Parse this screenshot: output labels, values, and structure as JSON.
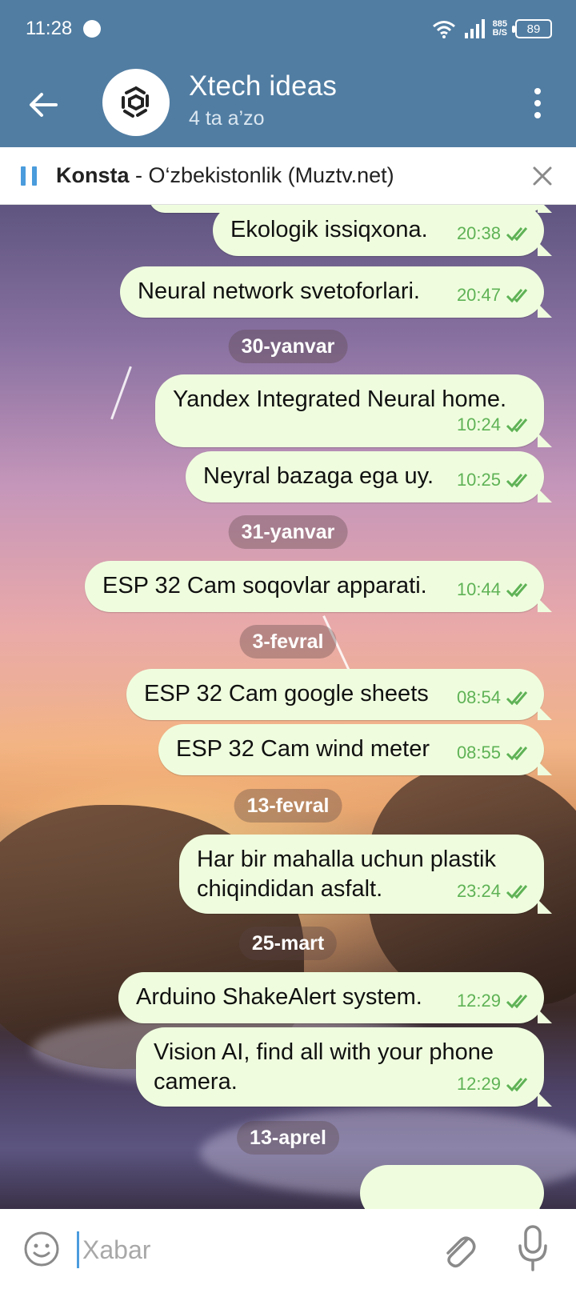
{
  "status_bar": {
    "time": "11:28",
    "net_speed": "885",
    "net_unit": "B/S",
    "battery": "89"
  },
  "header": {
    "title": "Xtech ideas",
    "subtitle": "4 ta a’zo"
  },
  "player": {
    "artist": "Konsta",
    "separator": " - ",
    "track": "O‘zbekistonlik (Muztv.net)"
  },
  "messages": [
    {
      "text": "Ekologik issiqxona.",
      "time": "20:38"
    },
    {
      "text": "Neural network svetoforlari.",
      "time": "20:47"
    },
    {
      "text": "Yandex Integrated Neural home.",
      "time": "10:24"
    },
    {
      "text": "Neyral bazaga ega uy.",
      "time": "10:25"
    },
    {
      "text": "ESP 32 Cam soqovlar apparati.",
      "time": "10:44"
    },
    {
      "text": "ESP 32 Cam google sheets",
      "time": "08:54"
    },
    {
      "text": "ESP 32 Cam wind meter",
      "time": "08:55"
    },
    {
      "text_line1": "Har bir mahalla uchun plastik",
      "text_line2": "chiqindidan asfalt.",
      "time": "23:24"
    },
    {
      "text": "Arduino ShakeAlert system.",
      "time": "12:29"
    },
    {
      "text_line1": "Vision AI, find all with your phone",
      "text_line2": "camera.",
      "time": "12:29"
    }
  ],
  "dates": [
    "30-yanvar",
    "31-yanvar",
    "3-fevral",
    "13-fevral",
    "25-mart",
    "13-aprel"
  ],
  "input": {
    "placeholder": "Xabar"
  },
  "colors": {
    "header_bg": "#517da2",
    "bubble_out": "#effdde",
    "check_color": "#5fb256",
    "accent": "#4a9cdc"
  }
}
